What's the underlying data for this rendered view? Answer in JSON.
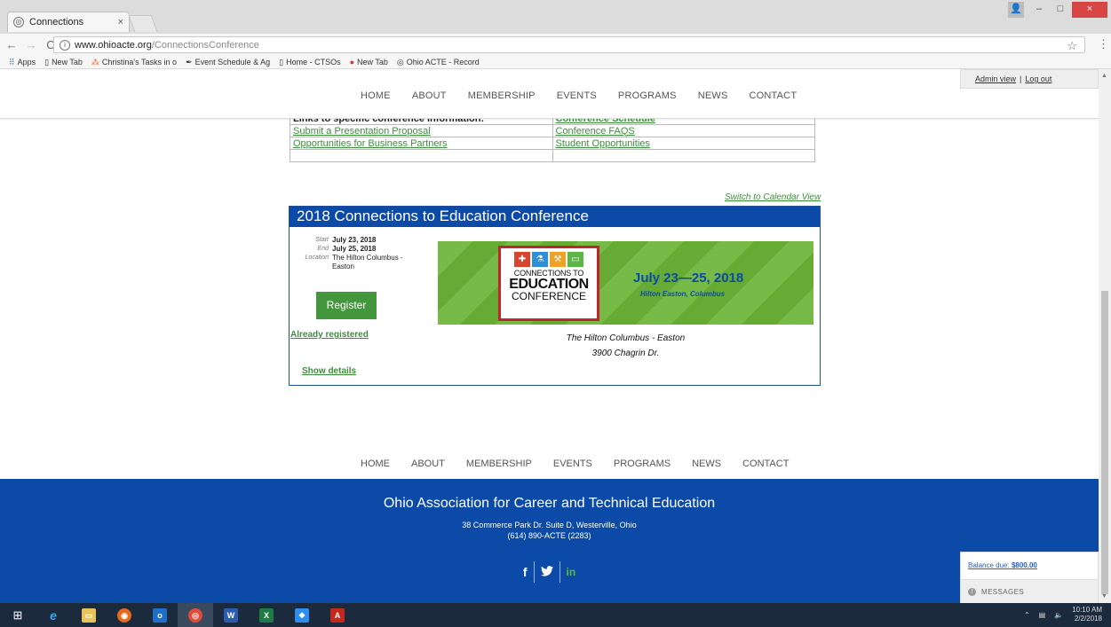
{
  "browser": {
    "tab_title": "Connections",
    "tab_close": "×",
    "url_host": "www.ohioacte.org",
    "url_path": "/ConnectionsConference",
    "win_min": "–",
    "win_max": "□",
    "win_close": "×",
    "bookmarks": [
      {
        "label": "Apps",
        "icon": "apps-grid"
      },
      {
        "label": "New Tab",
        "icon": "page"
      },
      {
        "label": "Christina's Tasks in o",
        "icon": "asana"
      },
      {
        "label": "Event Schedule & Ag",
        "icon": "feather"
      },
      {
        "label": "Home - CTSOs",
        "icon": "page"
      },
      {
        "label": "New Tab",
        "icon": "red-circle"
      },
      {
        "label": "Ohio ACTE - Record",
        "icon": "globe"
      }
    ]
  },
  "site": {
    "nav": [
      "HOME",
      "ABOUT",
      "MEMBERSHIP",
      "EVENTS",
      "PROGRAMS",
      "NEWS",
      "CONTACT"
    ],
    "admin_view": "Admin view",
    "admin_sep": "|",
    "log_out": "Log out"
  },
  "links_table": {
    "rows": [
      [
        "Links to specific conference information:",
        "Conference Schedule"
      ],
      [
        "Submit a Presentation Proposal",
        "Conference FAQS"
      ],
      [
        "Opportunities for Business Partners",
        "Student Opportunities"
      ],
      [
        "",
        ""
      ]
    ]
  },
  "calendar_link": "Switch to Calendar View",
  "event": {
    "title": "2018 Connections to Education Conference",
    "start_label": "Start",
    "start": "July 23, 2018",
    "end_label": "End",
    "end": "July 25, 2018",
    "location_label": "Location",
    "location": "The Hilton Columbus - Easton",
    "register_label": "Register",
    "already_registered": "Already registered",
    "show_details": "Show details",
    "banner": {
      "logo_line1": "CONNECTIONS TO",
      "logo_line2": "EDUCATION",
      "logo_line3": "CONFERENCE",
      "dates": "July 23—25, 2018",
      "venue": "Hilton Easton, Columbus"
    },
    "venue_name": "The Hilton Columbus - Easton",
    "venue_address": "3900 Chagrin Dr."
  },
  "footer": {
    "org_name": "Ohio Association for Career and Technical Education",
    "address": "38 Commerce Park Dr. Suite D, Westerville, Ohio",
    "phone": "(614) 890-ACTE (2283)",
    "social": [
      "f",
      "🐦",
      "in"
    ]
  },
  "widget": {
    "balance_label": "Balance due:",
    "balance_amount": "$800.00",
    "messages": "MESSAGES"
  },
  "taskbar": {
    "time": "10:10 AM",
    "date": "2/2/2018"
  },
  "colors": {
    "brand_blue": "#0b4aa6",
    "link_green": "#3b8f3b",
    "button_green": "#44963c"
  }
}
